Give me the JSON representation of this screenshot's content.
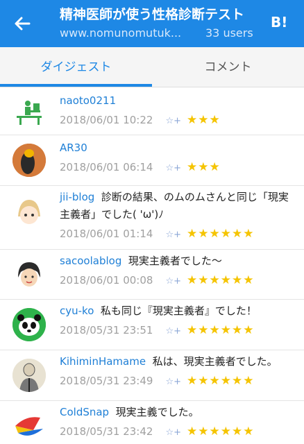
{
  "header": {
    "title": "精神医師が使う性格診断テスト",
    "url": "www.nomunomutuk...",
    "users": "33 users",
    "hatena_label": "B!"
  },
  "tabs": [
    {
      "label": "ダイジェスト"
    },
    {
      "label": "コメント"
    }
  ],
  "comments": [
    {
      "user": "naoto0211",
      "text": "",
      "date": "2018/06/01 10:22",
      "stars": "★★★",
      "star_count": 3
    },
    {
      "user": "AR30",
      "text": "",
      "date": "2018/06/01 06:14",
      "stars": "★★★",
      "star_count": 3
    },
    {
      "user": "jii-blog",
      "text": "診断の結果、のムのムさんと同じ「現実主義者」でした( 'ω')ﾉ",
      "date": "2018/06/01 01:14",
      "stars": "★★★★★★",
      "star_count": 6
    },
    {
      "user": "sacoolablog",
      "text": "現実主義者でした〜",
      "date": "2018/06/01 00:08",
      "stars": "★★★★★★",
      "star_count": 6
    },
    {
      "user": "cyu-ko",
      "text": "私も同じ『現実主義者』でした！",
      "date": "2018/05/31 23:51",
      "stars": "★★★★★★",
      "star_count": 6
    },
    {
      "user": "KihiminHamame",
      "text": "私は、現実主義者でした。",
      "date": "2018/05/31 23:49",
      "stars": "★★★★★★",
      "star_count": 6
    },
    {
      "user": "ColdSnap",
      "text": "現実主義でした。",
      "date": "2018/05/31 23:42",
      "stars": "★★★★★★",
      "star_count": 6
    }
  ],
  "add_star_icon": "☆+",
  "colors": {
    "header": "#1e88e5",
    "star": "#f5c400",
    "username": "#1e7fd6"
  }
}
